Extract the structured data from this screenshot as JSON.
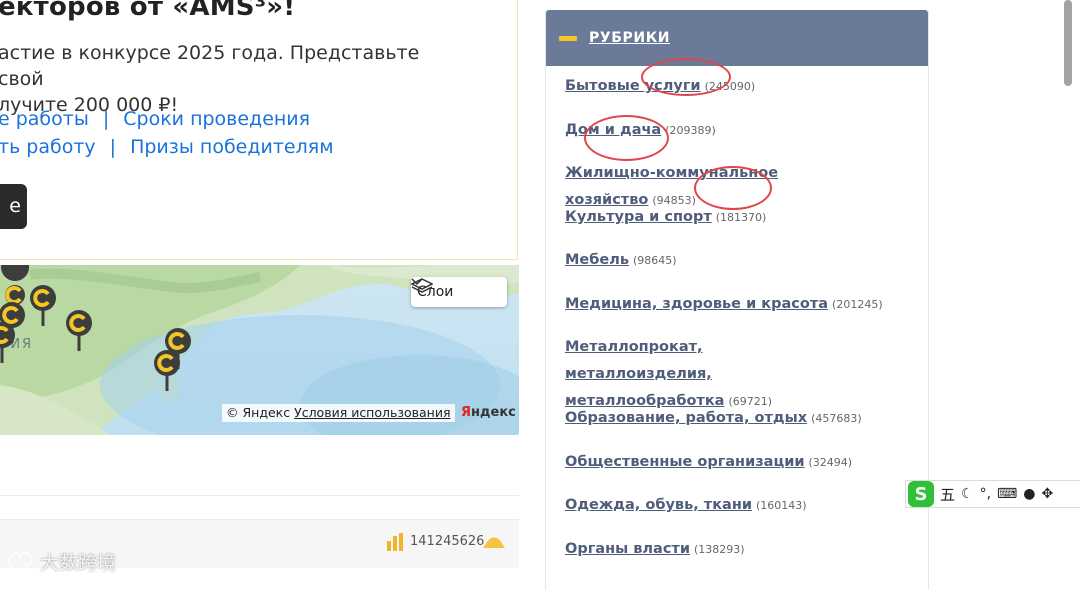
{
  "promo": {
    "title": "екторов от «AMS³»!",
    "description": "астие в конкурсе 2025 года. Представьте свой\nлучите 200 000 ₽!",
    "links_row1": [
      "е работы",
      "Сроки проведения"
    ],
    "links_row2": [
      "ть работу",
      "Призы победителям"
    ],
    "separator": "|",
    "button_label": "е"
  },
  "map": {
    "layers_label": "Слои",
    "region_label": "ЗИЯ",
    "copyright": "© Яндекс",
    "terms_link": "Условия использования",
    "brand_first_letter": "Я",
    "brand_rest": "ндекс"
  },
  "stats": {
    "count": "141245626"
  },
  "rubrics": {
    "title": "РУБРИКИ",
    "items": [
      {
        "name": "Бытовые услуги",
        "count": "(245090)"
      },
      {
        "name": "Дом и дача",
        "count": "(209389)"
      },
      {
        "name": "Жилищно-коммунальное хозяйство",
        "count": "(94853)"
      },
      {
        "name": "Культура и спорт",
        "count": "(181370)"
      },
      {
        "name": "Мебель",
        "count": "(98645)"
      },
      {
        "name": "Медицина, здоровье и красота",
        "count": "(201245)"
      },
      {
        "name": "Металлопрокат, металлоизделия, металлообработка",
        "count": "(69721)"
      },
      {
        "name": "Образование, работа, отдых",
        "count": "(457683)"
      },
      {
        "name": "Общественные организации",
        "count": "(32494)"
      },
      {
        "name": "Одежда, обувь, ткани",
        "count": "(160143)"
      },
      {
        "name": "Органы власти",
        "count": "(138293)"
      }
    ]
  },
  "ime": {
    "logo": "S",
    "mode_char": "五",
    "punct": "°,"
  },
  "watermark": {
    "text": "大数跨境"
  },
  "colors": {
    "accent_link": "#1a73d9",
    "rubric_header": "#6c7a99",
    "rubric_link": "#4f5d7b",
    "annotation": "#e0454a"
  }
}
